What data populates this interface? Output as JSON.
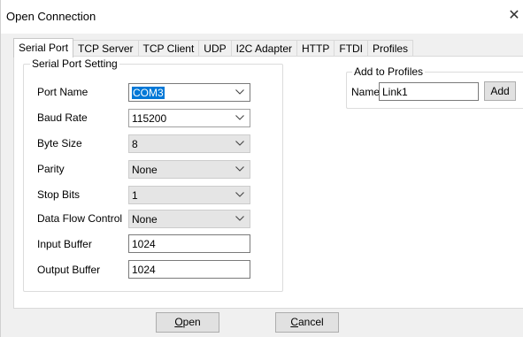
{
  "window": {
    "title": "Open Connection",
    "close_glyph": "✕"
  },
  "tabs": [
    {
      "label": "Serial Port",
      "active": true
    },
    {
      "label": "TCP Server"
    },
    {
      "label": "TCP Client"
    },
    {
      "label": "UDP"
    },
    {
      "label": "I2C Adapter"
    },
    {
      "label": "HTTP"
    },
    {
      "label": "FTDI"
    },
    {
      "label": "Profiles"
    }
  ],
  "serial": {
    "group_title": "Serial Port Setting",
    "port_name": {
      "label": "Port Name",
      "value": "COM3"
    },
    "baud_rate": {
      "label": "Baud Rate",
      "value": "115200"
    },
    "byte_size": {
      "label": "Byte Size",
      "value": "8"
    },
    "parity": {
      "label": "Parity",
      "value": "None"
    },
    "stop_bits": {
      "label": "Stop Bits",
      "value": "1"
    },
    "flow_control": {
      "label": "Data Flow Control",
      "value": "None"
    },
    "input_buffer": {
      "label": "Input Buffer",
      "value": "1024"
    },
    "output_buffer": {
      "label": "Output Buffer",
      "value": "1024"
    }
  },
  "profiles": {
    "group_title": "Add to Profiles",
    "name_label": "Name",
    "name_value": "Link1",
    "add_label": "Add"
  },
  "footer": {
    "open_mnemonic": "O",
    "open_rest": "pen",
    "cancel_mnemonic": "C",
    "cancel_rest": "ancel"
  },
  "icons": {
    "dropdown": "chevron-down-icon",
    "close": "close-icon"
  },
  "colors": {
    "selection": "#0078d7",
    "panel": "#ffffff",
    "dialog": "#f0f0f0"
  }
}
